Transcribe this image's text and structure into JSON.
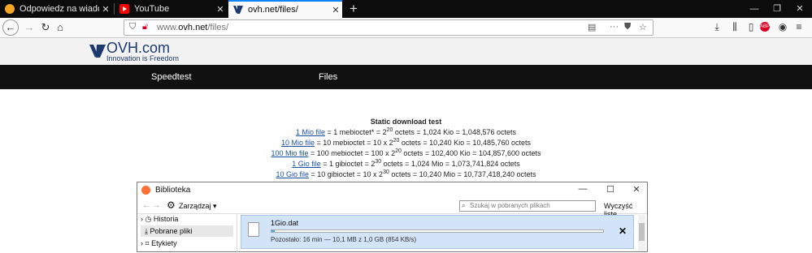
{
  "tabs": [
    {
      "title": "Odpowiedz na wiadomość - N",
      "icon": "forum-icon",
      "color": "#f5a623"
    },
    {
      "title": "YouTube",
      "icon": "youtube-icon",
      "color": "#ff0000"
    },
    {
      "title": "ovh.net/files/",
      "icon": "ovh-icon",
      "color": "#1c3a6e"
    }
  ],
  "url": {
    "prefix": "www.",
    "domain": "ovh.net",
    "path": "/files/"
  },
  "site": {
    "brand": "OVH.com",
    "tagline": "Innovation is Freedom",
    "menu": [
      "Speedtest",
      "Files"
    ]
  },
  "content": {
    "title": "Static download test",
    "rows": [
      {
        "link": "1 Mio file",
        "text": " = 1 mebioctet* = 2",
        "exp": "20",
        "rest": " octets = 1,024 Kio = 1,048,576 octets"
      },
      {
        "link": "10 Mio file",
        "text": " = 10 mebioctet = 10 x 2",
        "exp": "20",
        "rest": " octets = 10,240 Kio = 10,485,760 octets"
      },
      {
        "link": "100 Mio file",
        "text": " = 100 mebioctet = 100 x 2",
        "exp": "20",
        "rest": " octets = 102,400 Kio = 104,857,600 octets"
      },
      {
        "link": "1 Gio file",
        "text": " = 1 gibioctet = 2",
        "exp": "30",
        "rest": " octets = 1,024 Mio = 1,073,741,824 octets"
      },
      {
        "link": "10 Gio file",
        "text": " = 10 gibioctet = 10 x 2",
        "exp": "30",
        "rest": " octets = 10,240 Mio = 10,737,418,240 octets"
      }
    ]
  },
  "library": {
    "title": "Biblioteka",
    "manage": "Zarządzaj",
    "search_placeholder": "Szukaj w pobranych plikach",
    "clear": "Wyczyść listę",
    "sidebar": [
      "Historia",
      "Pobrane pliki",
      "Etykiety"
    ],
    "download": {
      "filename": "1Gio.dat",
      "progress": 0.01,
      "status": "Pozostało: 16 min — 10,1 MB z 1,0 GB (854 KB/s)"
    }
  }
}
